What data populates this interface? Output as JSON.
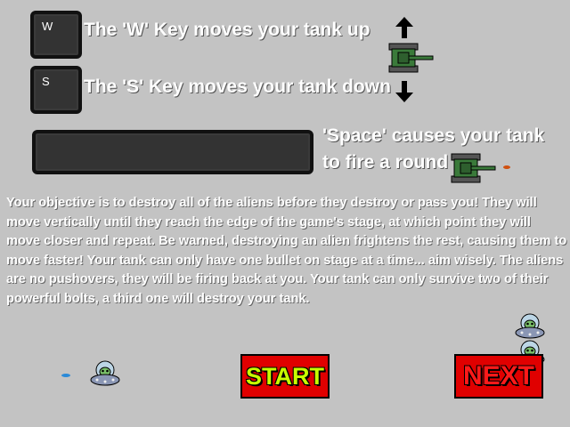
{
  "controls": {
    "w_key": "W",
    "w_text": "The 'W' Key moves your tank up",
    "s_key": "S",
    "s_text": "The 'S' Key moves your tank down",
    "space_text_1": "'Space' causes your tank",
    "space_text_2": "to fire a round"
  },
  "objective": "Your objective is to destroy all of the aliens before they destroy or pass you! They will move vertically until they reach the edge of the game's stage, at which point they will move closer and repeat. Be warned, destroying an alien frightens the rest, causing them to move faster! Your tank can only have one bullet on stage at a  time... aim wisely. The aliens are no pushovers, they will be firing back at you. Your tank can only survive two of their powerful bolts, a third one will destroy your tank.",
  "buttons": {
    "start": "START",
    "next": "NEXT"
  },
  "icons": [
    "up-arrow-icon",
    "down-arrow-icon",
    "tank-icon",
    "alien-ufo-icon",
    "bullet-icon"
  ],
  "colors": {
    "background": "#c3c3c3",
    "button_fill": "#e00000",
    "start_text": "#c8ff00",
    "next_text": "#ff1a1a",
    "tank": "#3a7a3a"
  }
}
